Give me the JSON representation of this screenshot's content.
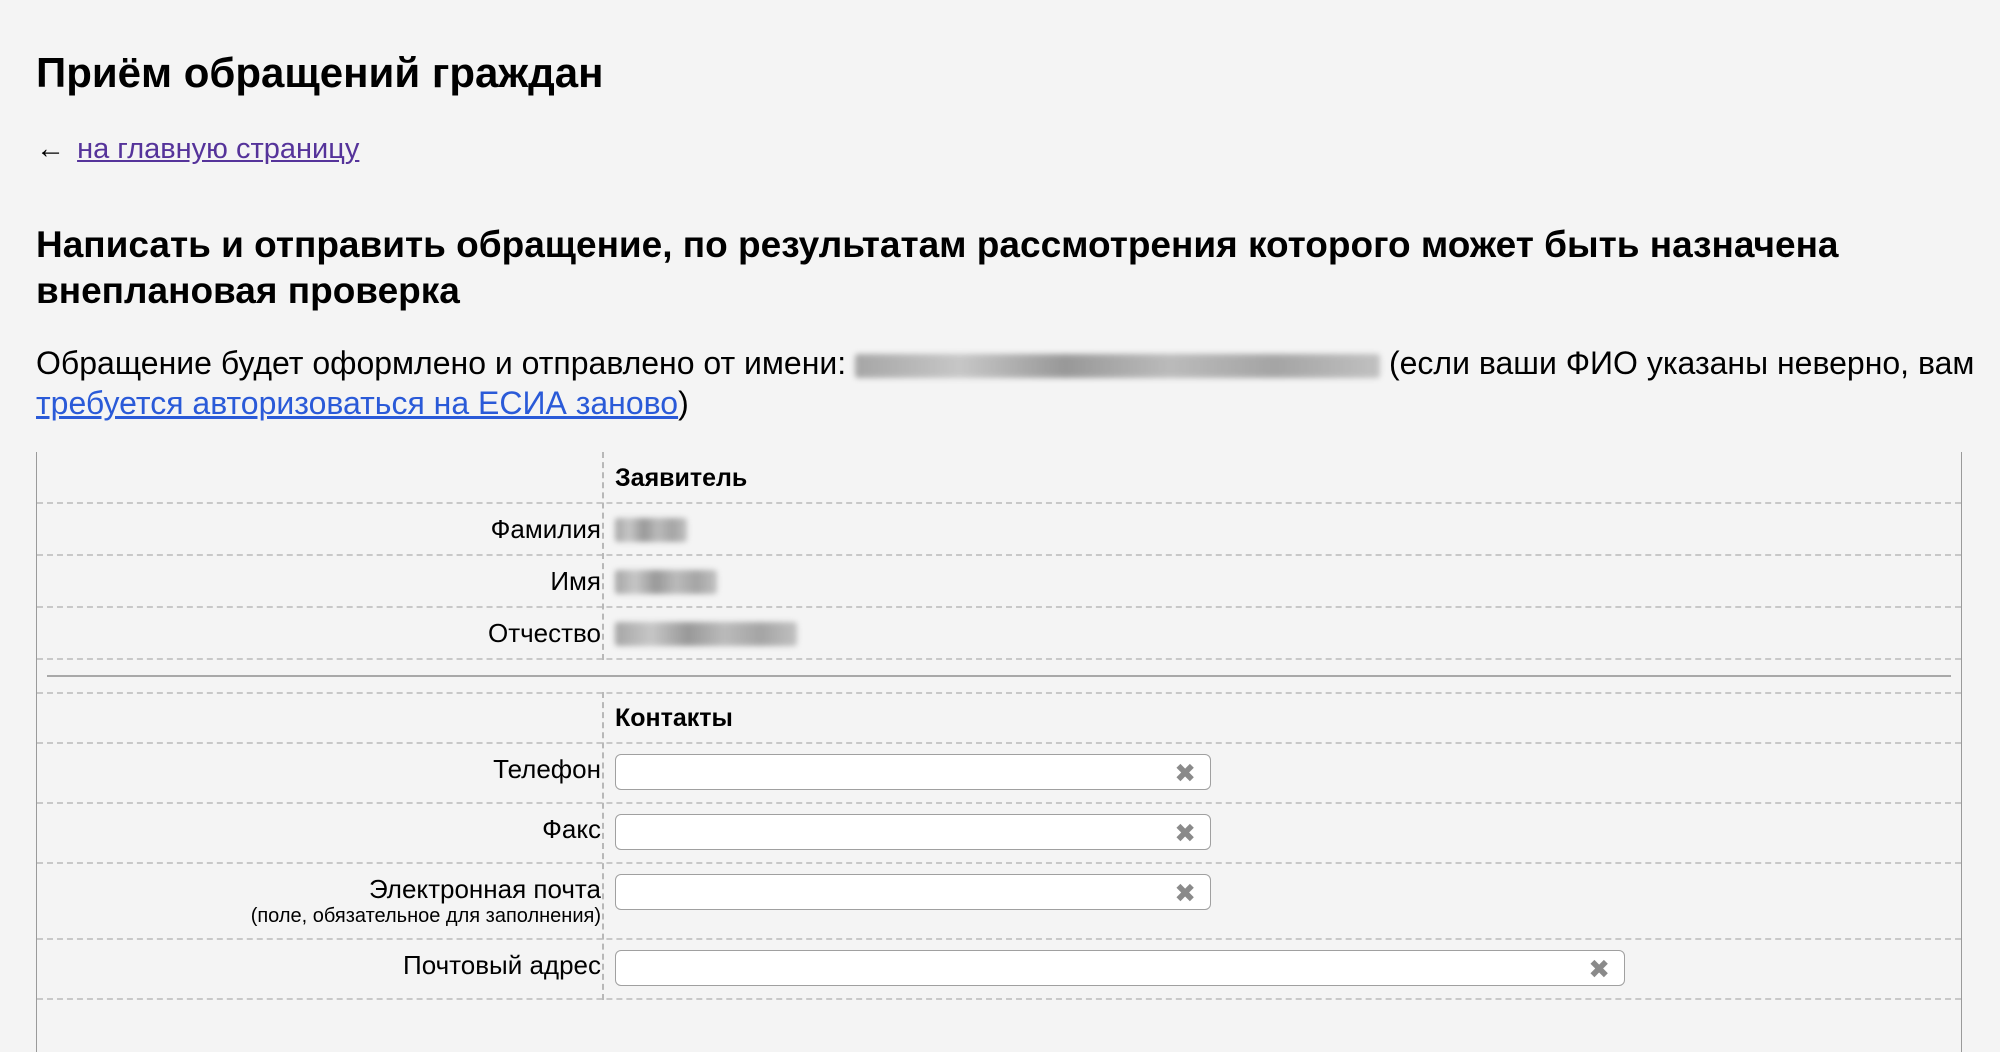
{
  "page": {
    "title": "Приём обращений граждан",
    "back_arrow": "←",
    "back_link": "на главную страницу",
    "heading": "Написать и отправить обращение, по результатам рассмотрения которого может быть назначена внеплановая проверка",
    "sender_prefix": "Обращение будет оформлено и отправлено от имени: ",
    "sender_middle": " (если ваши ФИО указаны неверно, вам ",
    "sender_link": "требуется авторизоваться на ЕСИА заново",
    "sender_suffix": ")"
  },
  "applicant": {
    "section_title": "Заявитель",
    "lastname_label": "Фамилия",
    "firstname_label": "Имя",
    "patronymic_label": "Отчество"
  },
  "contacts": {
    "section_title": "Контакты",
    "phone_label": "Телефон",
    "fax_label": "Факс",
    "email_label": "Электронная почта",
    "email_note": "(поле, обязательное для заполнения)",
    "address_label": "Почтовый адрес",
    "clear_symbol": "✖"
  }
}
